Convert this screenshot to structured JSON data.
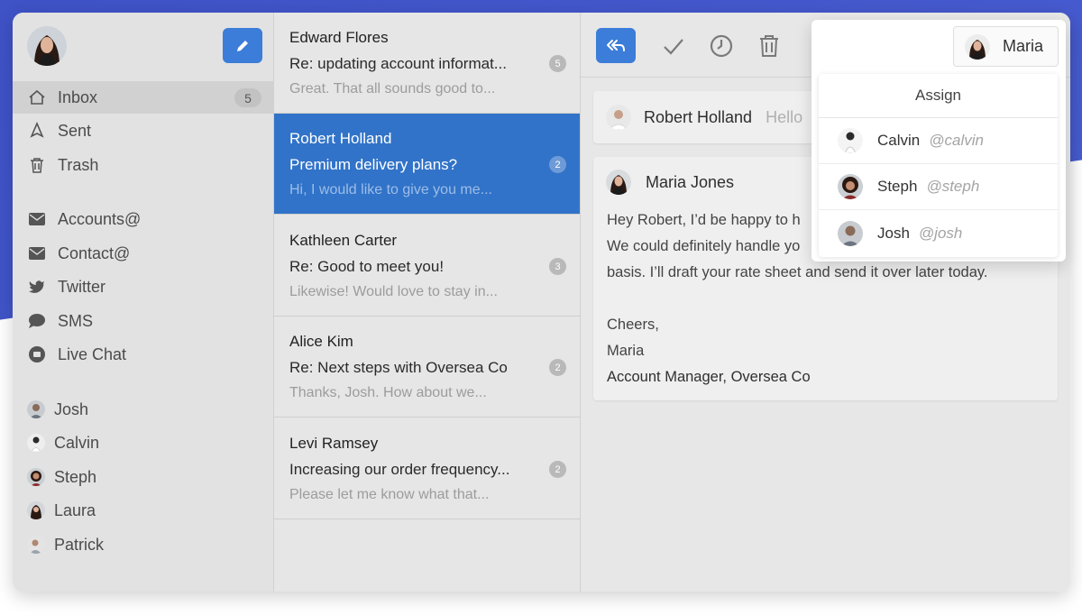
{
  "sidebar": {
    "compose_icon": "pencil-icon",
    "nav": [
      {
        "label": "Inbox",
        "icon": "home-icon",
        "count": "5"
      },
      {
        "label": "Sent",
        "icon": "send-icon"
      },
      {
        "label": "Trash",
        "icon": "trash-icon"
      }
    ],
    "channels": [
      {
        "label": "Accounts@",
        "icon": "envelope-icon"
      },
      {
        "label": "Contact@",
        "icon": "envelope-icon"
      },
      {
        "label": "Twitter",
        "icon": "twitter-icon"
      },
      {
        "label": "SMS",
        "icon": "chat-bubble-icon"
      },
      {
        "label": "Live Chat",
        "icon": "live-chat-icon"
      }
    ],
    "teammates": [
      {
        "label": "Josh"
      },
      {
        "label": "Calvin"
      },
      {
        "label": "Steph"
      },
      {
        "label": "Laura"
      },
      {
        "label": "Patrick"
      }
    ]
  },
  "conversations": [
    {
      "name": "Edward Flores",
      "subject": "Re: updating account informat...",
      "preview": "Great. That all sounds good to...",
      "count": "5"
    },
    {
      "name": "Robert Holland",
      "subject": "Premium delivery plans?",
      "preview": "Hi, I would like to give you me...",
      "count": "2"
    },
    {
      "name": "Kathleen Carter",
      "subject": "Re: Good to meet you!",
      "preview": "Likewise! Would love to stay in...",
      "count": "3"
    },
    {
      "name": "Alice Kim",
      "subject": "Re: Next steps with Oversea Co",
      "preview": "Thanks, Josh. How about we...",
      "count": "2"
    },
    {
      "name": "Levi Ramsey",
      "subject": "Increasing our order frequency...",
      "preview": "Please let me know what that...",
      "count": "2"
    }
  ],
  "toolbar": {
    "reply_icon": "reply-all-icon",
    "done_icon": "check-icon",
    "snooze_icon": "clock-icon",
    "delete_icon": "trash-icon"
  },
  "thread": {
    "collapsed": {
      "sender": "Robert Holland",
      "snippet": "Hello"
    },
    "open": {
      "sender": "Maria Jones",
      "lines": [
        "Hey Robert, I’d be happy to h",
        "We could definitely handle yo",
        "basis. I’ll draft your rate sheet and send it over later today."
      ],
      "closing": [
        "Cheers,",
        "Maria"
      ],
      "signature": "Account Manager, Oversea Co"
    }
  },
  "assign": {
    "current": "Maria",
    "title": "Assign",
    "options": [
      {
        "name": "Calvin",
        "handle": "@calvin"
      },
      {
        "name": "Steph",
        "handle": "@steph"
      },
      {
        "name": "Josh",
        "handle": "@josh"
      }
    ]
  },
  "colors": {
    "accent": "#3b7dd8",
    "selected_row": "#3173c8",
    "background_band": "#4556cc"
  }
}
